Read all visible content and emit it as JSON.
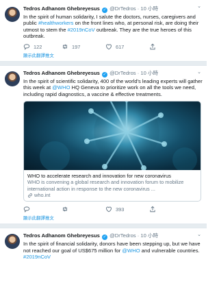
{
  "tweets": [
    {
      "author": "Tedros Adhanom Ghebreyesus",
      "handle": "@DrTedros",
      "time": "10 小時",
      "text_parts": [
        "In the spirit of human solidarity, I salute the doctors, nurses, caregivers and public ",
        "#healthworkers",
        " on the front lines who, at personal risk, are doing their utmost to stem the ",
        "#2019nCoV",
        " outbreak. They are the true heroes of this outbreak."
      ],
      "replies": "122",
      "retweets": "197",
      "likes": "617",
      "translate": "顯示此翻譯推文"
    },
    {
      "author": "Tedros Adhanom Ghebreyesus",
      "handle": "@DrTedros",
      "time": "10 小時",
      "text_parts": [
        "In the spirit of scientific solidarity, 400 of the world's leading experts will gather this week at ",
        "@WHO",
        " HQ Geneva to prioritize work on all the tools we need, including rapid diagnostics, a vaccine & effective treatments."
      ],
      "card": {
        "title": "WHO to accelerate research and innovation for new coronavirus",
        "description": "WHO is convening a global research and innovation forum to mobilize international action in response to the new coronavirus ...",
        "domain": "who.int"
      },
      "replies": "",
      "retweets": "",
      "likes": "393",
      "translate": "顯示此翻譯推文"
    },
    {
      "author": "Tedros Adhanom Ghebreyesus",
      "handle": "@DrTedros",
      "time": "10 小時",
      "text_parts": [
        "In the spirit of financial solidarity, donors have been stepping up, but we have not reached our goal of US$675 million for ",
        "@WHO",
        " and vulnerable countries. ",
        "#2019nCoV"
      ]
    }
  ]
}
